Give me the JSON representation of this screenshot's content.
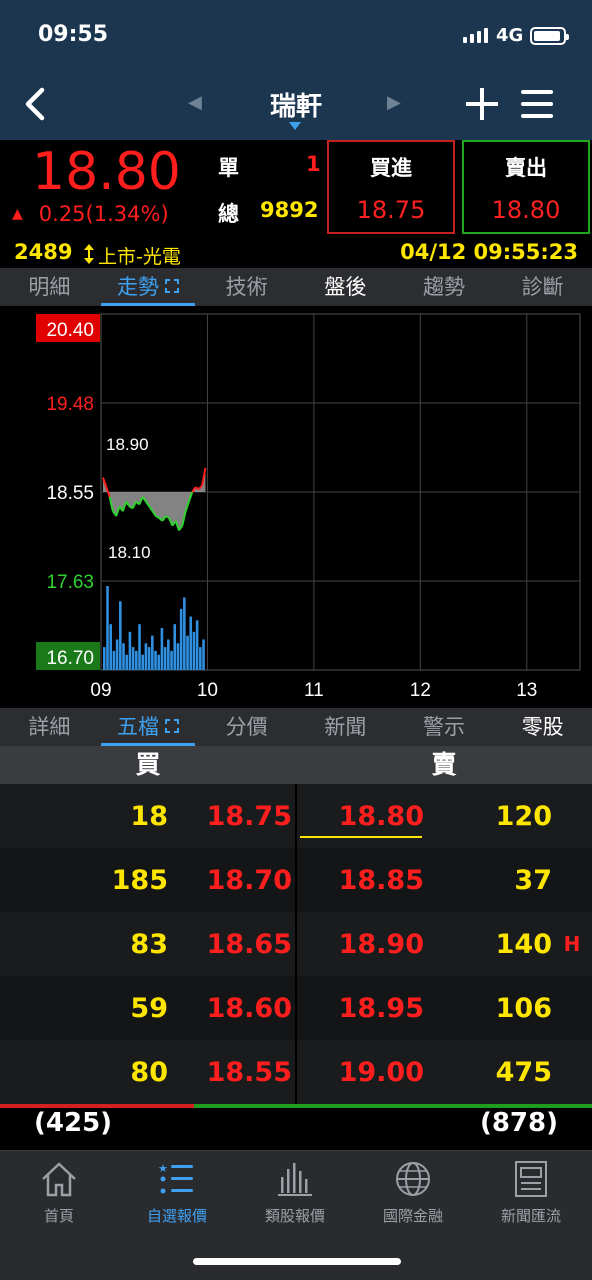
{
  "status": {
    "time": "09:55",
    "network": "4G"
  },
  "nav": {
    "title": "瑞軒"
  },
  "quote": {
    "price": "18.80",
    "change": "0.25(1.34%)",
    "single_label": "單",
    "single_value": "1",
    "total_label": "總",
    "total_value": "9892",
    "buy_label": "買進",
    "buy_value": "18.75",
    "sell_label": "賣出",
    "sell_value": "18.80",
    "code": "2489",
    "market": "上市-光電",
    "datetime": "04/12 09:55:23"
  },
  "tabs_top": [
    "明細",
    "走勢",
    "技術",
    "盤後",
    "趨勢",
    "診斷"
  ],
  "tabs_bottom": [
    "詳細",
    "五檔",
    "分價",
    "新聞",
    "警示",
    "零股"
  ],
  "chart_data": {
    "type": "line",
    "y_ticks": [
      "20.40",
      "19.48",
      "18.55",
      "17.63",
      "16.70"
    ],
    "x_ticks": [
      "09",
      "10",
      "11",
      "12",
      "13"
    ],
    "annotations": {
      "high": "18.90",
      "low": "18.10"
    },
    "ylim": [
      16.7,
      20.4
    ],
    "reference": 18.55,
    "price_series": [
      18.7,
      18.6,
      18.5,
      18.35,
      18.3,
      18.4,
      18.35,
      18.45,
      18.4,
      18.38,
      18.45,
      18.42,
      18.5,
      18.45,
      18.4,
      18.35,
      18.3,
      18.28,
      18.25,
      18.3,
      18.28,
      18.2,
      18.25,
      18.15,
      18.2,
      18.35,
      18.45,
      18.55,
      18.6,
      18.58,
      18.62,
      18.8
    ],
    "volume_series": [
      30,
      110,
      60,
      25,
      40,
      90,
      35,
      20,
      50,
      30,
      25,
      60,
      20,
      35,
      30,
      45,
      25,
      20,
      55,
      30,
      40,
      25,
      60,
      35,
      80,
      95,
      45,
      70,
      50,
      65,
      30,
      40
    ]
  },
  "orderbook": {
    "buy_label": "買",
    "sell_label": "賣",
    "rows": [
      {
        "bid_vol": "18",
        "bid": "18.75",
        "ask": "18.80",
        "ask_vol": "120",
        "flag": ""
      },
      {
        "bid_vol": "185",
        "bid": "18.70",
        "ask": "18.85",
        "ask_vol": "37",
        "flag": ""
      },
      {
        "bid_vol": "83",
        "bid": "18.65",
        "ask": "18.90",
        "ask_vol": "140",
        "flag": "H"
      },
      {
        "bid_vol": "59",
        "bid": "18.60",
        "ask": "18.95",
        "ask_vol": "106",
        "flag": ""
      },
      {
        "bid_vol": "80",
        "bid": "18.55",
        "ask": "19.00",
        "ask_vol": "475",
        "flag": ""
      }
    ],
    "bid_total": "(425)",
    "ask_total": "(878)"
  },
  "tabbar": [
    "首頁",
    "自選報價",
    "類股報價",
    "國際金融",
    "新聞匯流"
  ],
  "colors": {
    "up": "#ff1e1e",
    "down": "#2fd32f",
    "accent": "#3fa0f0",
    "volume": "#2f8fe0",
    "yellow": "#ffe600"
  }
}
